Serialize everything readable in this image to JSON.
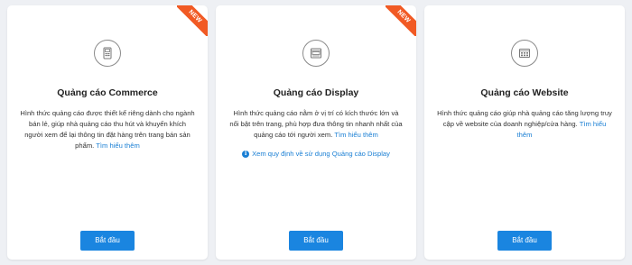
{
  "cards": [
    {
      "badge": "NEW",
      "icon": "commerce-icon",
      "title": "Quảng cáo Commerce",
      "description": "Hình thức quảng cáo được thiết kế riêng dành cho ngành bán lẻ, giúp nhà quảng cáo thu hút và khuyến khích người xem để lại thông tin đặt hàng trên trang bán sản phẩm.",
      "learn_more": "Tìm hiểu thêm",
      "button": "Bắt đầu"
    },
    {
      "badge": "NEW",
      "icon": "display-icon",
      "title": "Quảng cáo Display",
      "description": "Hình thức quảng cáo nằm ở vị trí có kích thước lớn và nổi bật trên trang, phù hợp đưa thông tin nhanh nhất của quảng cáo tới người xem.",
      "learn_more": "Tìm hiểu thêm",
      "policy_link": "Xem quy định về sử dụng Quảng cáo Display",
      "button": "Bắt đầu"
    },
    {
      "icon": "website-icon",
      "title": "Quảng cáo Website",
      "description": "Hình thức quảng cáo giúp nhà quảng cáo tăng lượng truy cập về website của doanh nghiệp/cửa hàng.",
      "learn_more": "Tìm hiểu thêm",
      "button": "Bắt đầu"
    }
  ],
  "colors": {
    "accent": "#1a85e0",
    "link": "#1a7fd4",
    "badge": "#f15a24",
    "background": "#eef0f4"
  }
}
